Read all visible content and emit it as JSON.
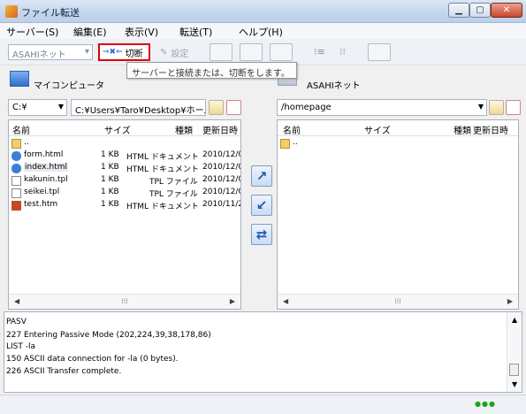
{
  "window": {
    "title": "ファイル転送"
  },
  "menu": [
    "サーバー(S)",
    "編集(E)",
    "表示(V)",
    "転送(T)",
    "ヘルプ(H)"
  ],
  "toolbar": {
    "server_value": "ASAHIネット",
    "disconnect_label": "切断",
    "settings_label": "設定"
  },
  "tooltip": "サーバーと接続または、切断をします。",
  "local": {
    "label": "マイコンピュータ",
    "drive": "C:¥",
    "path": "C:¥Users¥Taro¥Desktop¥ホーム",
    "columns": [
      "名前",
      "サイズ",
      "種類",
      "更新日時"
    ],
    "rows": [
      {
        "name": "..",
        "size": "",
        "type": "",
        "date": "",
        "icon": "folder"
      },
      {
        "name": "form.html",
        "size": "1 KB",
        "type": "HTML ドキュメント",
        "date": "2010/12/0",
        "icon": "html"
      },
      {
        "name": "index.html",
        "size": "1 KB",
        "type": "HTML ドキュメント",
        "date": "2010/12/0",
        "icon": "html"
      },
      {
        "name": "kakunin.tpl",
        "size": "1 KB",
        "type": "TPL ファイル",
        "date": "2010/12/0",
        "icon": "doc"
      },
      {
        "name": "seikei.tpl",
        "size": "1 KB",
        "type": "TPL ファイル",
        "date": "2010/12/0",
        "icon": "doc"
      },
      {
        "name": "test.htm",
        "size": "1 KB",
        "type": "HTML ドキュメント",
        "date": "2010/11/2",
        "icon": "htm"
      }
    ]
  },
  "remote": {
    "label": "ASAHIネット",
    "path": "/homepage",
    "columns": [
      "名前",
      "サイズ",
      "種類",
      "更新日時"
    ],
    "rows": [
      {
        "name": "..",
        "icon": "folder"
      }
    ]
  },
  "log": [
    "PASV",
    "227  Entering Passive Mode (202,224,39,38,178,86)",
    "LIST -la",
    "150  ASCII data connection for -la (0 bytes).",
    "226  ASCII Transfer complete."
  ],
  "colors": {
    "accent": "#e00000",
    "status": "#1aa51a"
  }
}
